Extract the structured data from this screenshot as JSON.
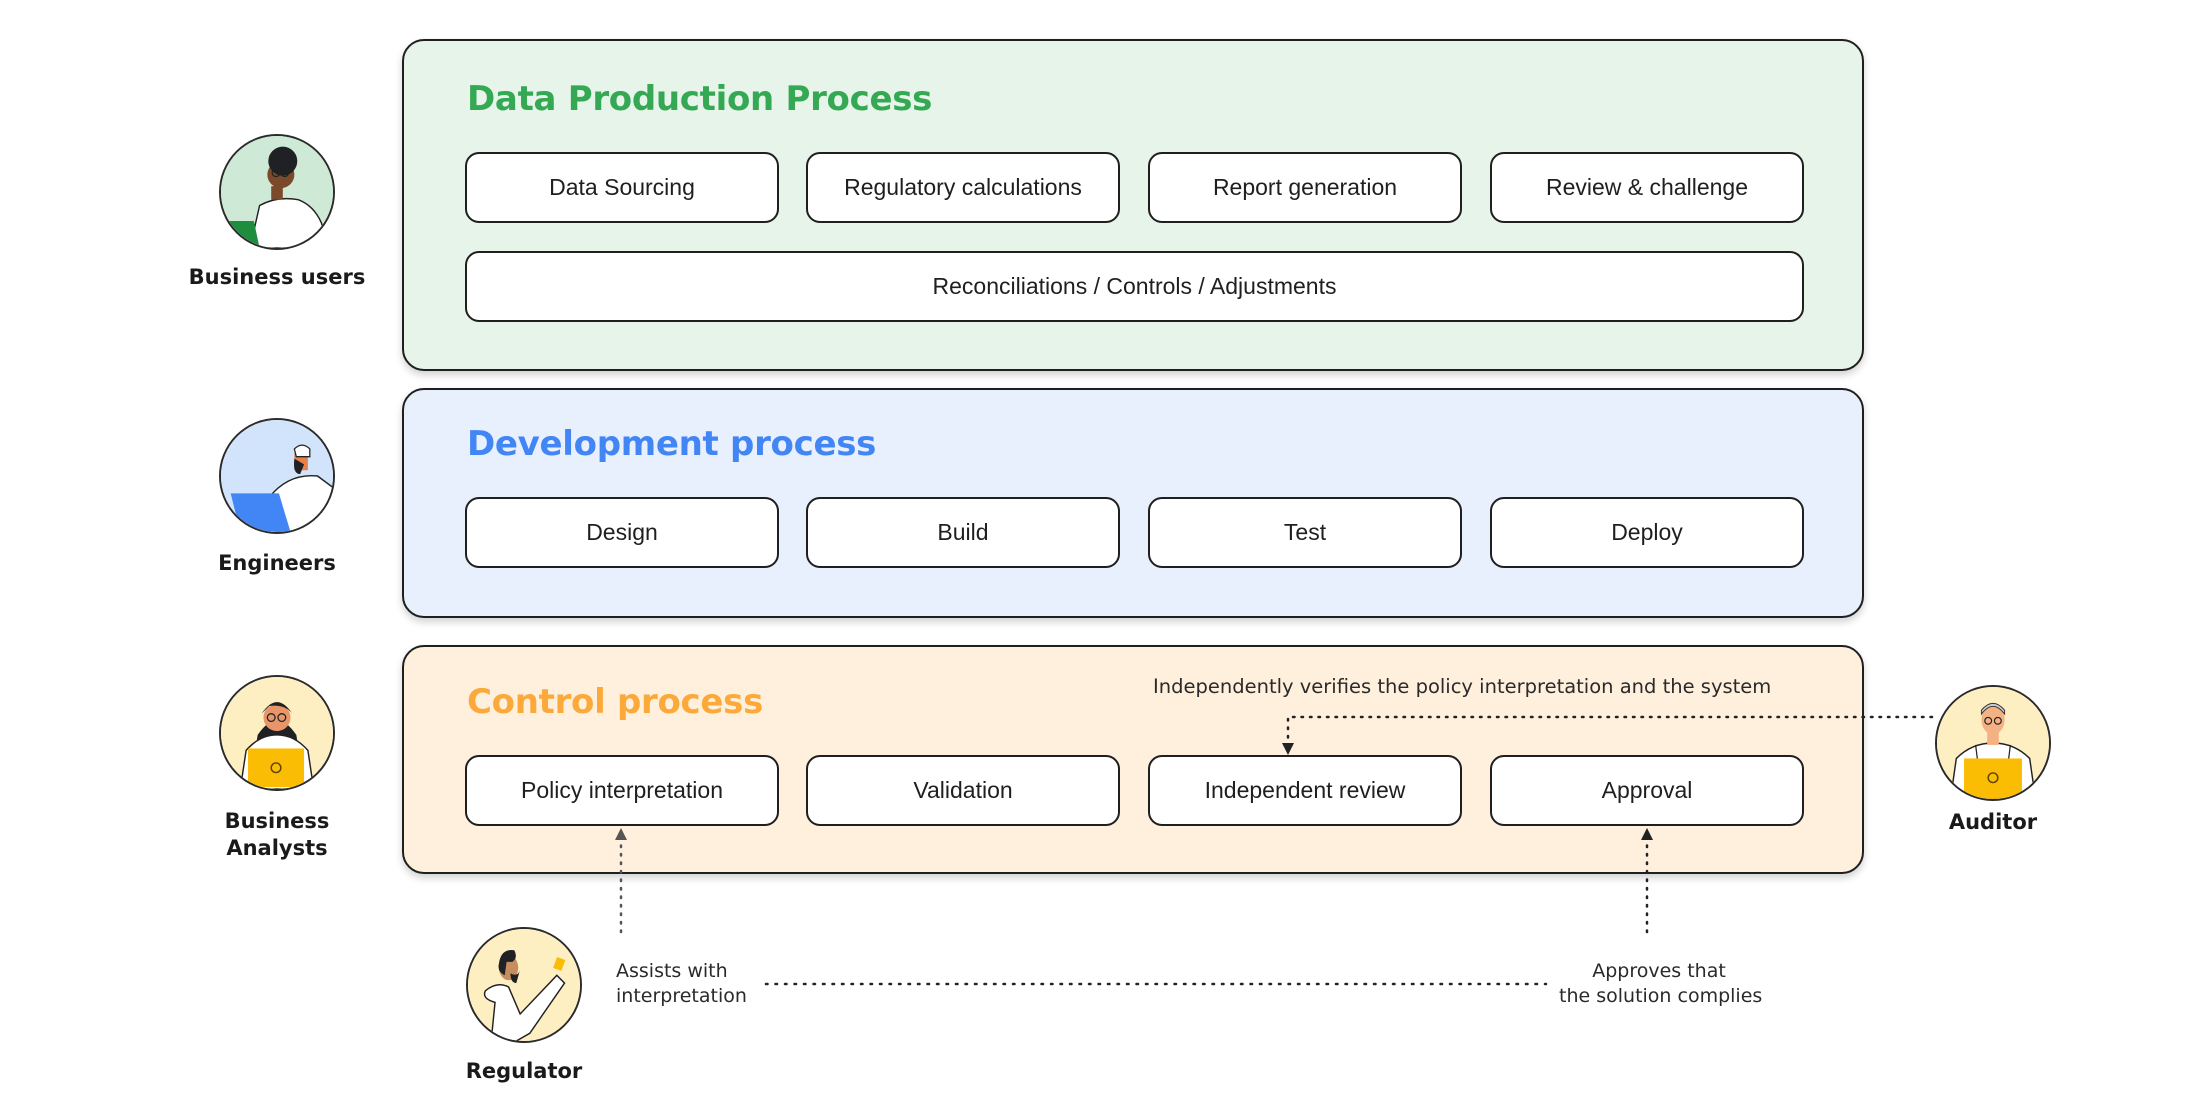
{
  "colors": {
    "data_production_bg": "#E6F4EA",
    "data_production_title": "#34A853",
    "development_bg": "#E8F0FE",
    "development_title": "#4285F4",
    "control_bg": "#FEF0DD",
    "control_title": "#FBA93A"
  },
  "personas": [
    {
      "id": "business-users",
      "label": "Business users",
      "icon": "business-user-avatar-icon"
    },
    {
      "id": "engineers",
      "label": "Engineers",
      "icon": "engineer-avatar-icon"
    },
    {
      "id": "business-analysts",
      "label_line1": "Business",
      "label_line2": "Analysts",
      "icon": "business-analyst-avatar-icon"
    },
    {
      "id": "auditor",
      "label": "Auditor",
      "icon": "auditor-avatar-icon"
    },
    {
      "id": "regulator",
      "label": "Regulator",
      "icon": "regulator-avatar-icon"
    }
  ],
  "sections": {
    "data_production": {
      "title": "Data Production Process",
      "steps": [
        "Data Sourcing",
        "Regulatory calculations",
        "Report generation",
        "Review & challenge"
      ],
      "wide_step": "Reconciliations / Controls / Adjustments"
    },
    "development": {
      "title": "Development process",
      "steps": [
        "Design",
        "Build",
        "Test",
        "Deploy"
      ]
    },
    "control": {
      "title": "Control process",
      "steps": [
        "Policy interpretation",
        "Validation",
        "Independent review",
        "Approval"
      ],
      "annotation": "Independently verifies the policy interpretation and the system"
    }
  },
  "notes": {
    "assists_line1": "Assists with",
    "assists_line2": "interpretation",
    "approves_line1": "Approves that",
    "approves_line2": "the solution complies"
  }
}
